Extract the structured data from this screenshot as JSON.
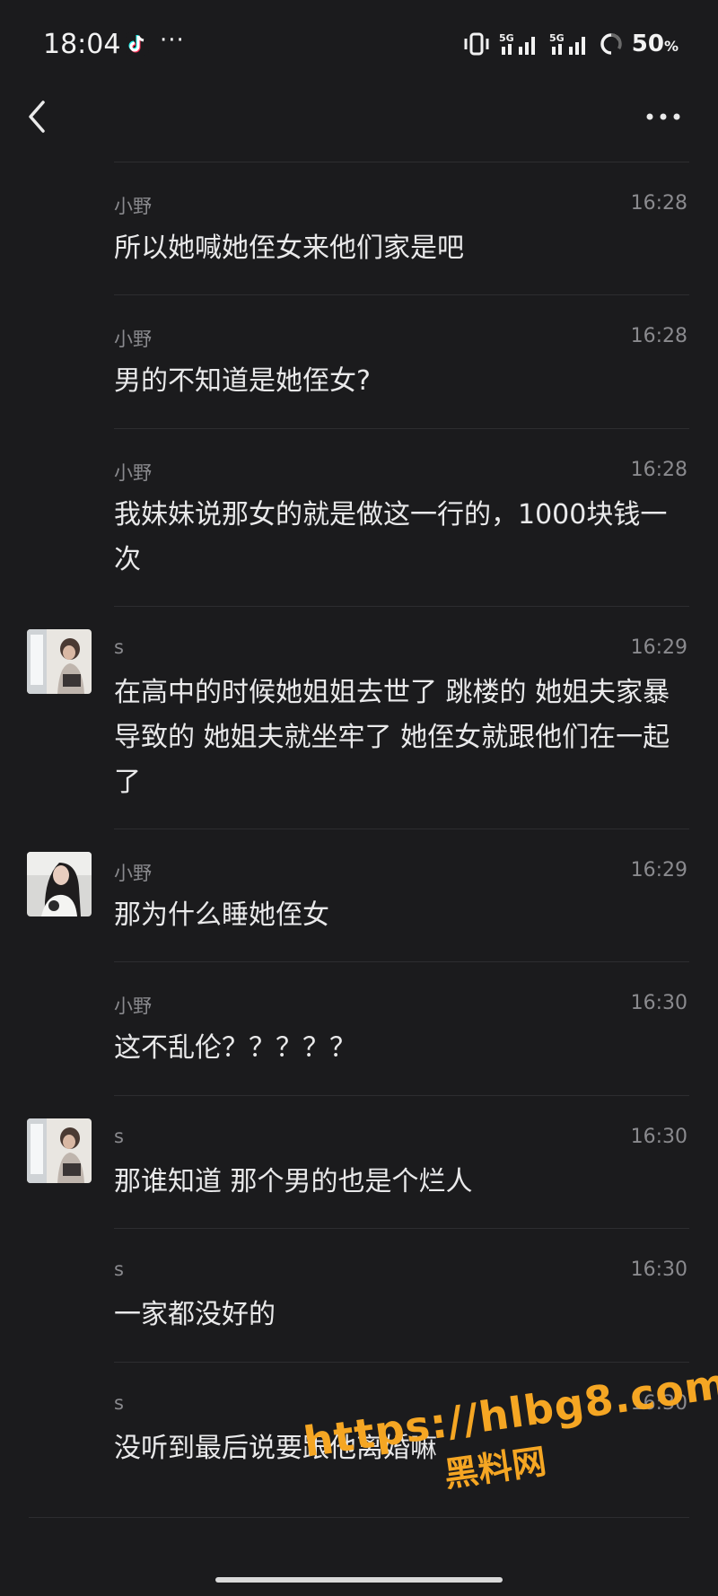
{
  "status_bar": {
    "time": "18:04",
    "more_indicator": "···",
    "battery_value": "50",
    "battery_unit": "%",
    "icons": [
      "tiktok-icon",
      "vibrate-icon",
      "signal-5g-icon",
      "signal-5g-icon",
      "battery-ring-icon"
    ]
  },
  "header": {
    "back_icon": "chevron-left-icon",
    "more_icon": "more-horizontal-icon"
  },
  "messages": [
    {
      "name": "小野",
      "time": "16:28",
      "text": "所以她喊她侄女来他们家是吧",
      "avatar": "none"
    },
    {
      "name": "小野",
      "time": "16:28",
      "text": "男的不知道是她侄女?",
      "avatar": "none"
    },
    {
      "name": "小野",
      "time": "16:28",
      "text": "我妹妹说那女的就是做这一行的，1000块钱一次",
      "avatar": "none"
    },
    {
      "name": "s",
      "time": "16:29",
      "text": "在高中的时候她姐姐去世了 跳楼的 她姐夫家暴导致的 她姐夫就坐牢了 她侄女就跟他们在一起了",
      "avatar": "photo-s"
    },
    {
      "name": "小野",
      "time": "16:29",
      "text": "那为什么睡她侄女",
      "avatar": "photo-xiaoye"
    },
    {
      "name": "小野",
      "time": "16:30",
      "text": "这不乱伦？？？？？",
      "avatar": "none"
    },
    {
      "name": "s",
      "time": "16:30",
      "text": "那谁知道 那个男的也是个烂人",
      "avatar": "photo-s"
    },
    {
      "name": "s",
      "time": "16:30",
      "text": "一家都没好的",
      "avatar": "none"
    },
    {
      "name": "s",
      "time": "16:30",
      "text": "没听到最后说要跟他离婚嘛",
      "avatar": "none"
    }
  ],
  "watermark": {
    "url": "https://hlbg8.com",
    "label": "黑料网",
    "color": "#f5a623"
  },
  "colors": {
    "background": "#1b1b1d",
    "primary_text": "#e9e9ea",
    "secondary_text": "#8a8a8e",
    "divider": "#2d2d30"
  }
}
